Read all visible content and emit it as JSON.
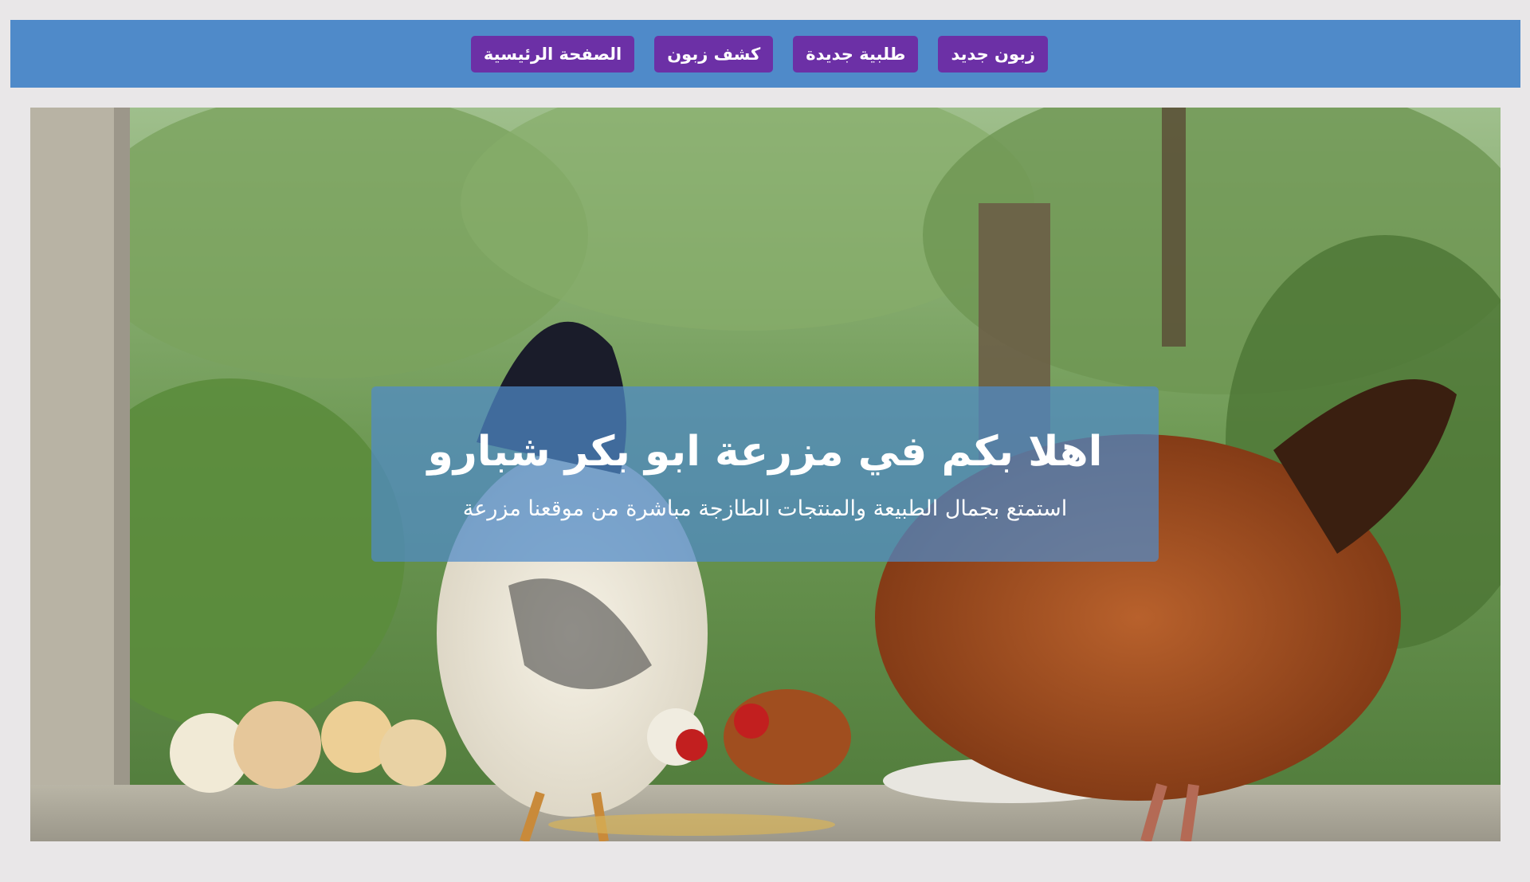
{
  "nav": {
    "items": [
      {
        "label": "زبون جديد"
      },
      {
        "label": "طلبية جديدة"
      },
      {
        "label": "كشف زبون"
      },
      {
        "label": "الصفحة الرئيسية"
      }
    ]
  },
  "hero": {
    "image": "chickens-feeding-photo",
    "title": "اهلا بكم في مزرعة ابو بكر شبارو",
    "subtitle": "استمتع بجمال الطبيعة والمنتجات الطازجة مباشرة من موقعنا مزرعة"
  },
  "colors": {
    "page_bg": "#e9e7e8",
    "navbar_bg": "#4f8ac9",
    "nav_button_bg": "#6c30a6",
    "hero_box_bg": "#4f8ac9"
  }
}
